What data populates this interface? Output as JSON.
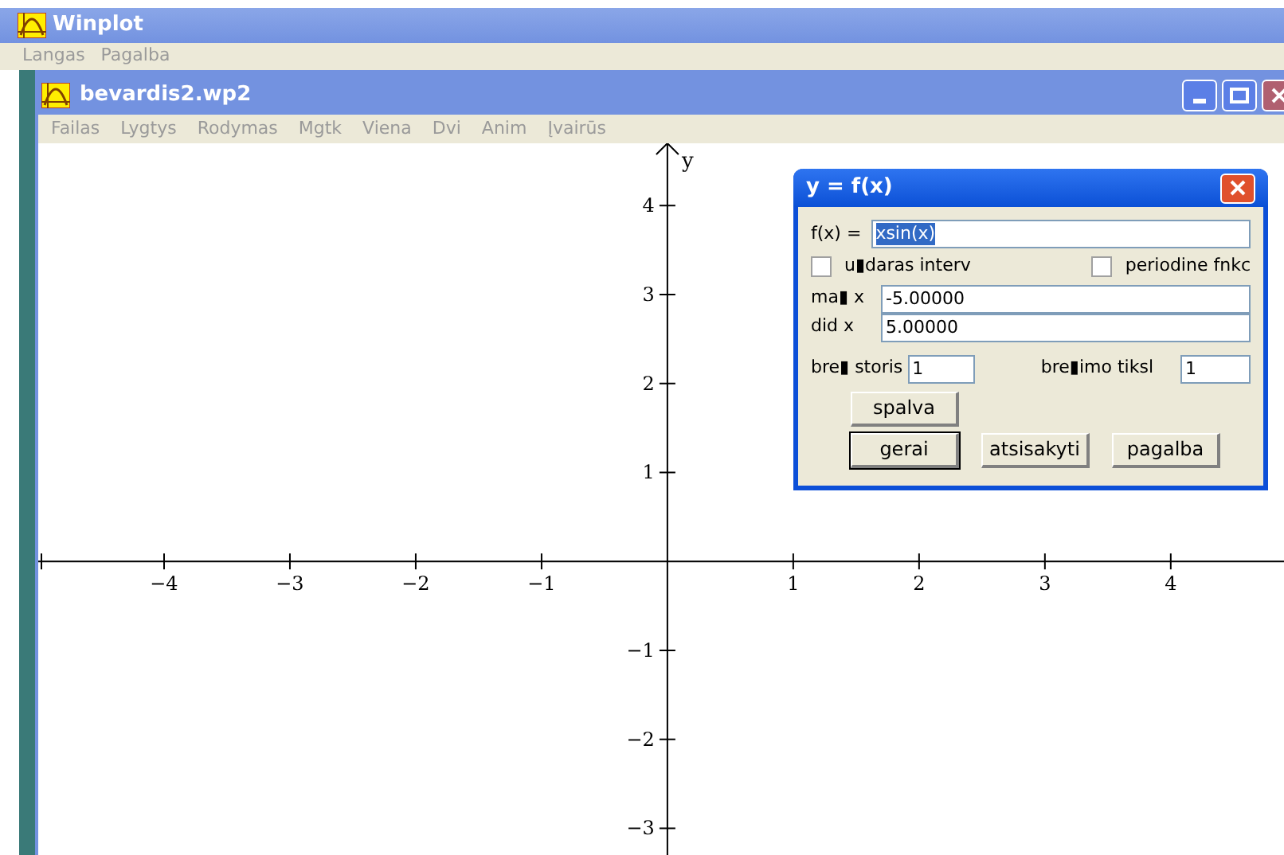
{
  "app": {
    "title": "Winplot",
    "menu": [
      "Langas",
      "Pagalba"
    ]
  },
  "document": {
    "title": "bevardis2.wp2",
    "menu": [
      "Failas",
      "Lygtys",
      "Rodymas",
      "Mgtk",
      "Viena",
      "Dvi",
      "Anim",
      "Įvairūs"
    ],
    "chart_data": {
      "type": "line",
      "ylabel": "y",
      "xlim": [
        -5,
        4.9
      ],
      "ylim": [
        -3.3,
        4.7
      ],
      "xticks": [
        {
          "value": -4,
          "label": "−4"
        },
        {
          "value": -3,
          "label": "−3"
        },
        {
          "value": -2,
          "label": "−2"
        },
        {
          "value": -1,
          "label": "−1"
        },
        {
          "value": 1,
          "label": "1"
        },
        {
          "value": 2,
          "label": "2"
        },
        {
          "value": 3,
          "label": "3"
        },
        {
          "value": 4,
          "label": "4"
        }
      ],
      "yticks": [
        {
          "value": 4,
          "label": "4"
        },
        {
          "value": 3,
          "label": "3"
        },
        {
          "value": 2,
          "label": "2"
        },
        {
          "value": 1,
          "label": "1"
        },
        {
          "value": -1,
          "label": "−1"
        },
        {
          "value": -2,
          "label": "−2"
        },
        {
          "value": -3,
          "label": "−3"
        }
      ]
    }
  },
  "dialog": {
    "title": "y = f(x)",
    "function": {
      "label": "f(x) =",
      "value": "xsin(x)",
      "selected": true
    },
    "checkboxes": [
      {
        "label": "u▮daras interv",
        "checked": false
      },
      {
        "label": "periodine fnkc",
        "checked": false
      }
    ],
    "range": [
      {
        "label": "ma▮ x",
        "value": "-5.00000"
      },
      {
        "label": "did x",
        "value": "5.00000"
      }
    ],
    "small_fields": [
      {
        "label": "bre▮ storis",
        "value": "1"
      },
      {
        "label": "bre▮imo tiksl",
        "value": "1"
      }
    ],
    "color_button": "spalva",
    "buttons": [
      {
        "label": "gerai",
        "selected": true
      },
      {
        "label": "atsisakyti",
        "selected": false
      },
      {
        "label": "pagalba",
        "selected": false
      }
    ]
  }
}
